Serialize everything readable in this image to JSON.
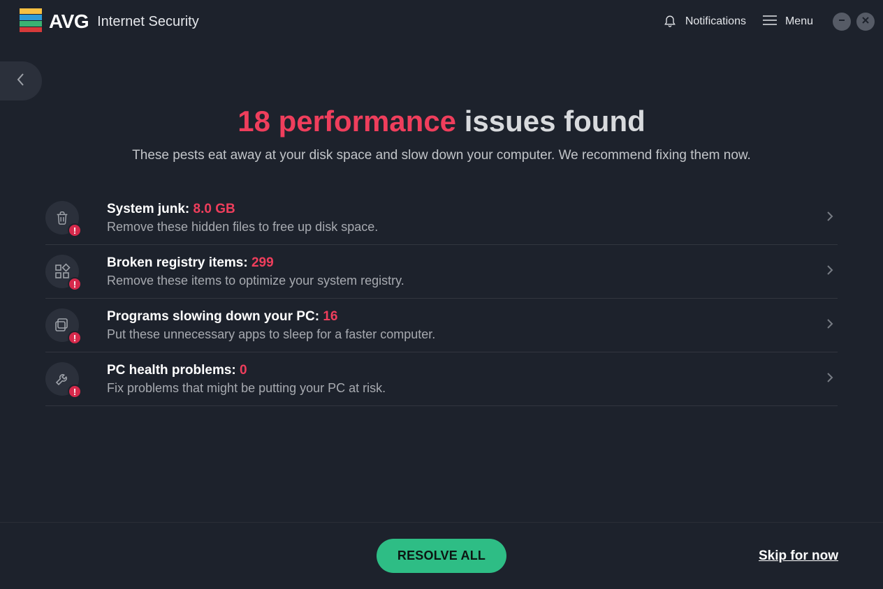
{
  "header": {
    "brand_name": "AVG",
    "brand_sub": "Internet Security",
    "notifications_label": "Notifications",
    "menu_label": "Menu"
  },
  "headline": {
    "accent": "18 performance",
    "rest": "issues found"
  },
  "subhead": "These pests eat away at your disk space and slow down your computer. We recommend fixing them now.",
  "issues": [
    {
      "label": "System junk:",
      "value": "8.0 GB",
      "desc": "Remove these hidden files to free up disk space."
    },
    {
      "label": "Broken registry items:",
      "value": "299",
      "desc": "Remove these items to optimize your system registry."
    },
    {
      "label": "Programs slowing down your PC:",
      "value": "16",
      "desc": "Put these unnecessary apps to sleep for a faster computer."
    },
    {
      "label": "PC health problems:",
      "value": "0",
      "desc": "Fix problems that might be putting your PC at risk."
    }
  ],
  "footer": {
    "resolve": "RESOLVE ALL",
    "skip": "Skip for now"
  }
}
